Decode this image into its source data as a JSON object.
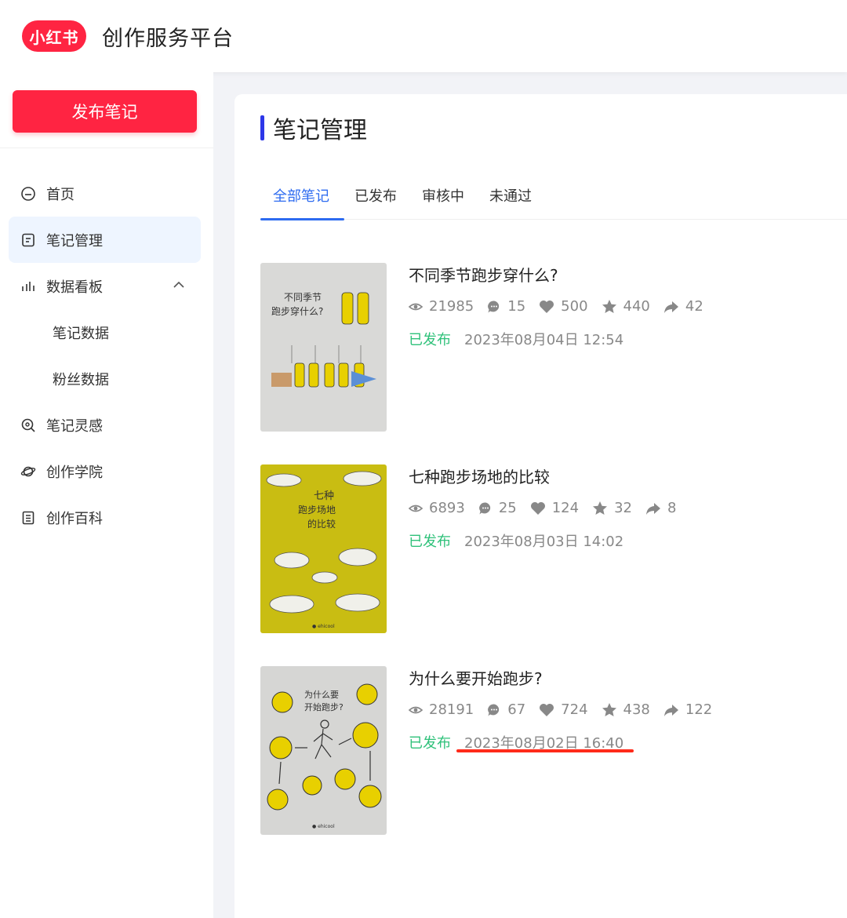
{
  "header": {
    "logo_text": "小红书",
    "platform_title": "创作服务平台"
  },
  "sidebar": {
    "publish_label": "发布笔记",
    "items": [
      {
        "label": "首页",
        "icon": "home-icon"
      },
      {
        "label": "笔记管理",
        "icon": "note-icon",
        "active": true
      },
      {
        "label": "数据看板",
        "icon": "bar-chart-icon",
        "expanded": true
      },
      {
        "label": "笔记数据",
        "sub": true
      },
      {
        "label": "粉丝数据",
        "sub": true
      },
      {
        "label": "笔记灵感",
        "icon": "inspiration-icon"
      },
      {
        "label": "创作学院",
        "icon": "planet-icon"
      },
      {
        "label": "创作百科",
        "icon": "document-icon"
      }
    ]
  },
  "main": {
    "title": "笔记管理",
    "tabs": [
      "全部笔记",
      "已发布",
      "审核中",
      "未通过"
    ],
    "notes": [
      {
        "title": "不同季节跑步穿什么?",
        "thumb_text": [
          "不同季节",
          "跑步穿什么?"
        ],
        "views": "21985",
        "comments": "15",
        "likes": "500",
        "collects": "440",
        "shares": "42",
        "status": "已发布",
        "date": "2023年08月04日 12:54"
      },
      {
        "title": "七种跑步场地的比较",
        "thumb_text": [
          "七种",
          "跑步场地",
          "的比较"
        ],
        "views": "6893",
        "comments": "25",
        "likes": "124",
        "collects": "32",
        "shares": "8",
        "status": "已发布",
        "date": "2023年08月03日 14:02"
      },
      {
        "title": "为什么要开始跑步?",
        "thumb_text": [
          "为什么要",
          "开始跑步?"
        ],
        "views": "28191",
        "comments": "67",
        "likes": "724",
        "collects": "438",
        "shares": "122",
        "status": "已发布",
        "date": "2023年08月02日 16:40"
      }
    ]
  },
  "colors": {
    "brand": "#ff2442",
    "accent": "#2d6bf0",
    "status_green": "#2fc17a",
    "annotation_red": "#ff2a1a"
  }
}
